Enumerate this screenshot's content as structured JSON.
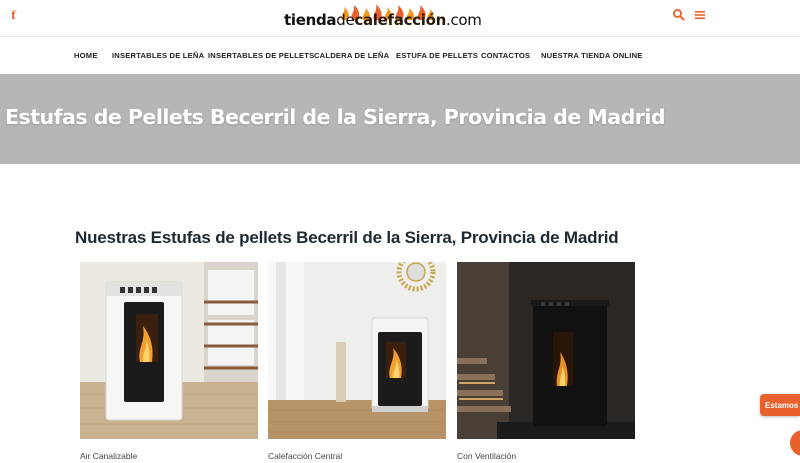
{
  "header": {
    "logo": {
      "part1": "tienda",
      "part2": "de",
      "part3": "calefacción",
      "part4": ".com"
    },
    "icons": {
      "social": "facebook-icon",
      "search": "search-icon",
      "menu": "menu-icon"
    },
    "accent_color": "#e8602c"
  },
  "nav": {
    "items": [
      {
        "label": "HOME"
      },
      {
        "label": "INSERTABLES DE LEÑA"
      },
      {
        "label": "INSERTABLES DE PELLETS"
      },
      {
        "label": "CALDERA DE LEÑA"
      },
      {
        "label": "ESTUFA DE PELLETS"
      },
      {
        "label": "CONTACTOS"
      },
      {
        "label": "NUESTRA TIENDA ONLINE"
      }
    ]
  },
  "hero": {
    "title": "Estufas de Pellets Becerril de la Sierra, Provincia de Madrid",
    "background": "#b6b6b6"
  },
  "section": {
    "title": "Nuestras Estufas de pellets Becerril de la Sierra, Provincia de Madrid"
  },
  "products": [
    {
      "caption": "Air Canalizable"
    },
    {
      "caption": "Calefacción Central"
    },
    {
      "caption": "Con Ventilación"
    }
  ],
  "chat": {
    "label": "Estamos"
  }
}
